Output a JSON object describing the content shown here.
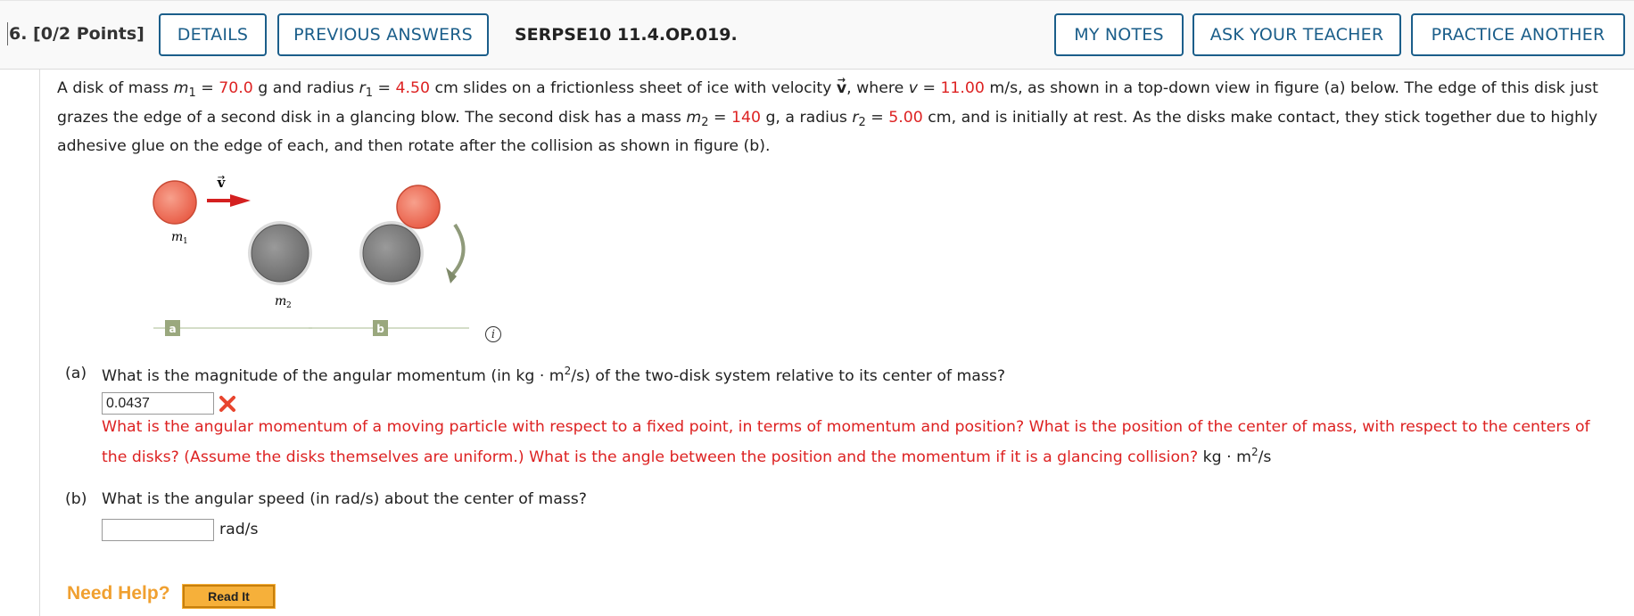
{
  "header": {
    "question_number": "6. [0/2 Points]",
    "details_label": "DETAILS",
    "previous_answers_label": "PREVIOUS ANSWERS",
    "question_id": "SERPSE10 11.4.OP.019.",
    "my_notes_label": "MY NOTES",
    "ask_teacher_label": "ASK YOUR TEACHER",
    "practice_another_label": "PRACTICE ANOTHER",
    "accent_color": "#1b5e8a"
  },
  "problem": {
    "t1": "A disk of mass ",
    "m1_sym": "m",
    "m1_sub": "1",
    "eq": " = ",
    "m1_val": "70.0",
    "t2": " g and radius ",
    "r1_sym": "r",
    "r1_sub": "1",
    "r1_val": "4.50",
    "t3": " cm slides on a frictionless sheet of ice with velocity ",
    "v_vec": "v",
    "v_arrow": "→",
    "t4": ", where ",
    "v_sym": "v",
    "v_val": "11.00",
    "t5": " m/s, as shown in a top-down view in figure (a) below. The edge of this disk just grazes the edge of a second disk in a glancing blow. The second disk has a mass ",
    "m2_sym": "m",
    "m2_sub": "2",
    "m2_val": "140",
    "t6": " g, a radius ",
    "r2_sym": "r",
    "r2_sub": "2",
    "r2_val": "5.00",
    "t7": " cm, and is initially at rest. As the disks make contact, they stick together due to highly adhesive glue on the edge of each, and then rotate after the collision as shown in figure (b).",
    "value_color": "#dd2222"
  },
  "figure": {
    "m1_label": "m",
    "m1_label_sub": "1",
    "m2_label": "m",
    "m2_label_sub": "2",
    "v_label": "v",
    "v_label_arrow": "→",
    "panel_a": "a",
    "panel_b": "b",
    "info_icon": "i",
    "disk1_color": "#f07060",
    "disk2_color": "#888888",
    "arrow_color": "#d42020"
  },
  "part_a": {
    "label": "(a)",
    "question": "What is the magnitude of the angular momentum (in kg · m",
    "sup": "2",
    "question_end": "/s) of the two-disk system relative to its center of mass?",
    "answer_value": "0.0437",
    "status_icon": "x-mark-icon",
    "hint_text": "What is the angular momentum of a moving particle with respect to a fixed point, in terms of momentum and position? What is the position of the center of mass, with respect to the centers of the disks? (Assume the disks themselves are uniform.) What is the angle between the position and the momentum if it is a glancing collision?",
    "unit": " kg · m",
    "unit_sup": "2",
    "unit_end": "/s"
  },
  "part_b": {
    "label": "(b)",
    "question": "What is the angular speed (in rad/s) about the center of mass?",
    "answer_value": "",
    "unit": "rad/s"
  },
  "help": {
    "need_help": "Need Help?",
    "read_it": "Read It"
  }
}
